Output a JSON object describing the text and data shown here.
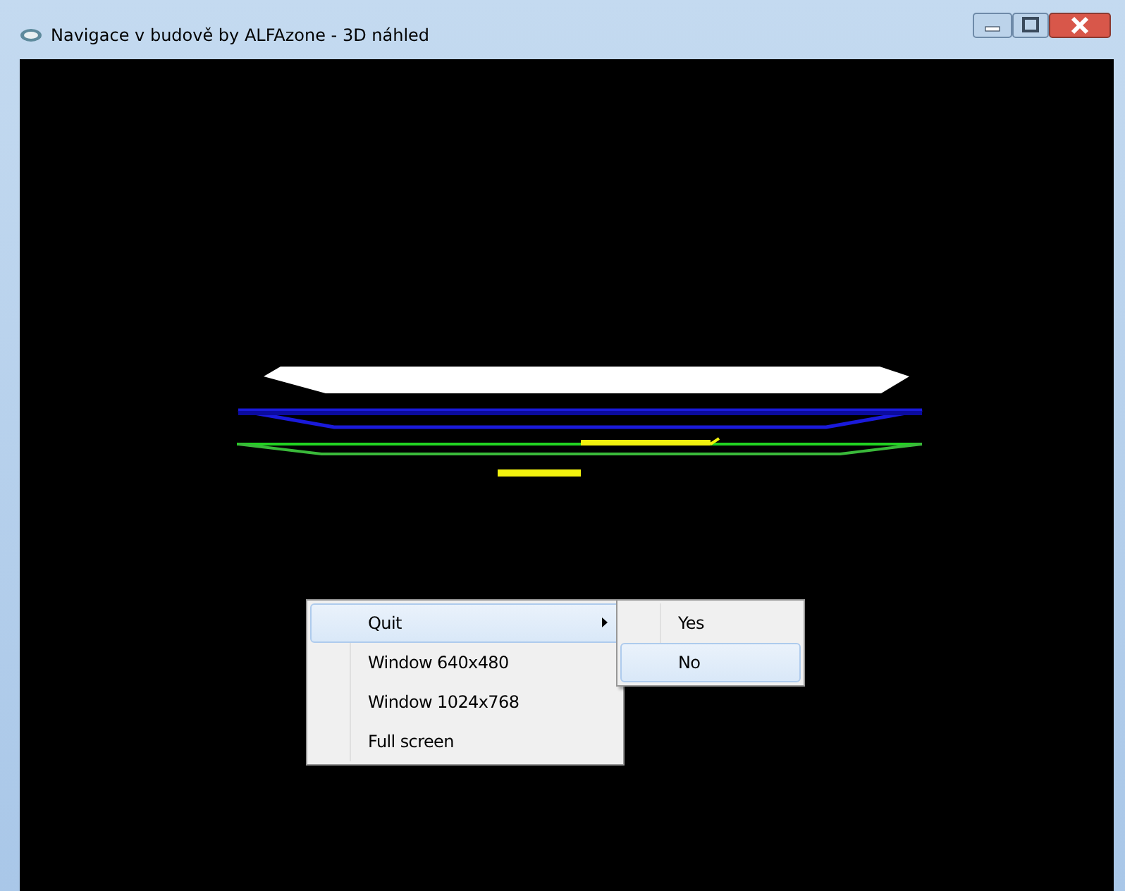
{
  "window": {
    "title": "Navigace v budově by ALFAzone - 3D náhled"
  },
  "context_menu": {
    "items": [
      {
        "label": "Quit",
        "selected": true,
        "submenu": true
      },
      {
        "label": "Window 640x480",
        "selected": false,
        "submenu": false
      },
      {
        "label": "Window 1024x768",
        "selected": false,
        "submenu": false
      },
      {
        "label": "Full screen",
        "selected": false,
        "submenu": false
      }
    ]
  },
  "submenu": {
    "items": [
      {
        "label": "Yes",
        "selected": false
      },
      {
        "label": "No",
        "selected": true
      }
    ]
  }
}
